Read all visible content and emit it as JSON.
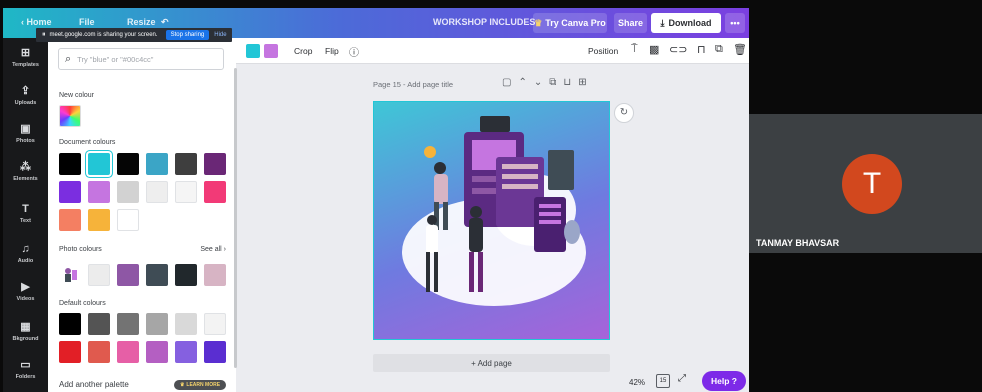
{
  "topbar": {
    "home": "Home",
    "file": "File",
    "resize": "Resize",
    "workshop": "WORKSHOP INCLUDES",
    "try_pro": "Try Canva Pro",
    "share": "Share",
    "download": "Download",
    "more": "•••"
  },
  "share_banner": {
    "text": "meet.google.com is sharing your screen.",
    "stop": "Stop sharing",
    "hide": "Hide"
  },
  "sidebar": {
    "items": [
      {
        "icon": "⊞",
        "label": "Templates"
      },
      {
        "icon": "⇪",
        "label": "Uploads"
      },
      {
        "icon": "▣",
        "label": "Photos"
      },
      {
        "icon": "⁂",
        "label": "Elements"
      },
      {
        "icon": "T",
        "label": "Text"
      },
      {
        "icon": "♫",
        "label": "Audio"
      },
      {
        "icon": "▶",
        "label": "Videos"
      },
      {
        "icon": "▦",
        "label": "Bkground"
      },
      {
        "icon": "▭",
        "label": "Folders"
      }
    ]
  },
  "panel": {
    "search_placeholder": "Try \"blue\" or \"#00c4cc\"",
    "new_colour": "New colour",
    "document_colours": "Document colours",
    "photo_colours": "Photo colours",
    "see_all": "See all",
    "default_colours": "Default colours",
    "add_palette": "Add another palette",
    "learn_more": "LEARN MORE",
    "doc_swatches": [
      "#000000",
      "#22c6d6",
      "#050505",
      "#3ba5c6",
      "#3e3e3e",
      "#6a2776",
      "#7b2ee0",
      "#c575e0",
      "#d2d2d2",
      "#eeeeee",
      "#f5f5f5",
      "#f23a77",
      "#f47f62",
      "#f6b33a",
      "#ffffff"
    ],
    "photo_swatches": [
      "#ececec",
      "#8e57a5",
      "#3f4c55",
      "#21282c",
      "#d7b4c4"
    ],
    "default_swatches": [
      "#000000",
      "#545454",
      "#737373",
      "#a6a6a6",
      "#d9d9d9",
      "#f3f3f3",
      "#e21f26",
      "#e05a4e",
      "#e65fa6",
      "#b45fc2",
      "#8560e0",
      "#5a2ed1"
    ]
  },
  "toolbar": {
    "crop": "Crop",
    "flip": "Flip",
    "info": "ⓘ",
    "position": "Position",
    "colors": [
      "#22c6d6",
      "#c575e0"
    ]
  },
  "canvas": {
    "page_title": "Page 15 - Add page title",
    "add_page": "+ Add page",
    "zoom": "42%",
    "page_count": "15",
    "help": "Help ?"
  },
  "meet": {
    "initial": "T",
    "name": "TANMAY BHAVSAR"
  }
}
